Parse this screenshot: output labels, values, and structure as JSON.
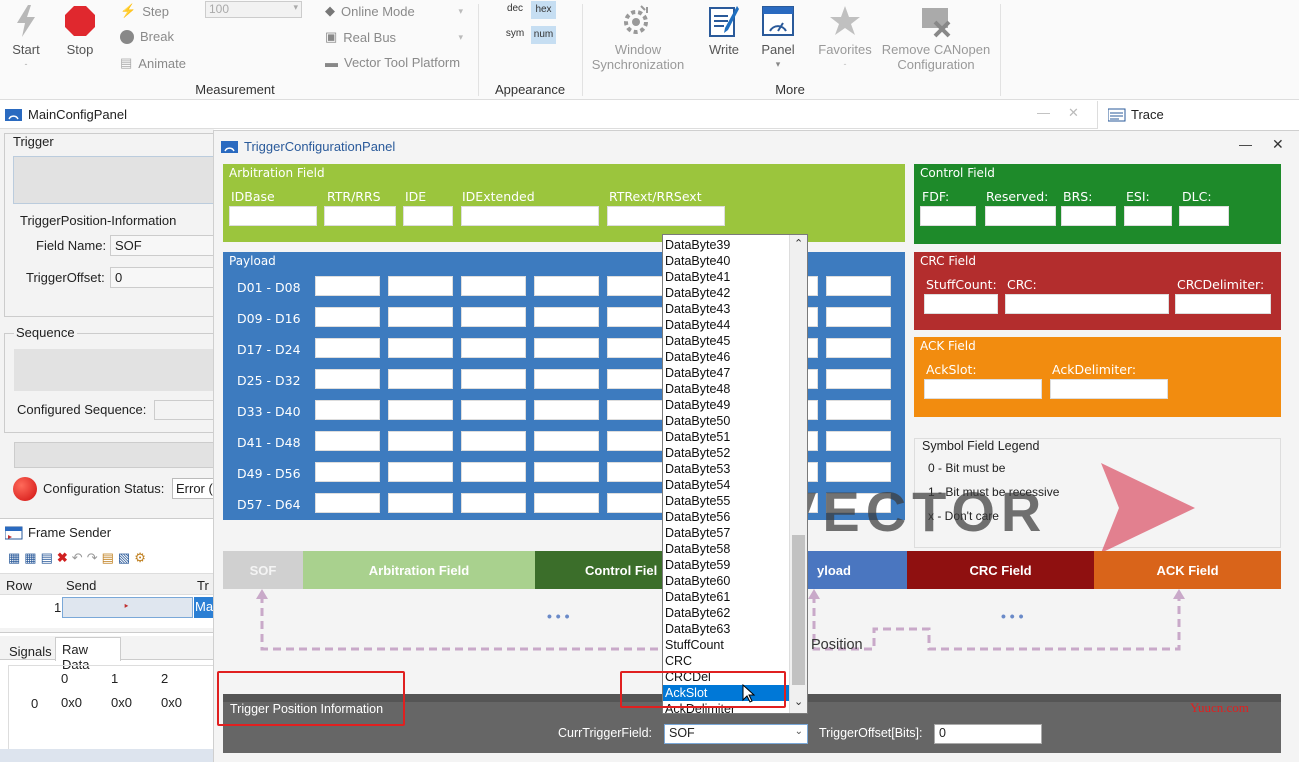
{
  "ribbon": {
    "start": "Start",
    "stop": "Stop",
    "step": "Step",
    "break": "Break",
    "animate": "Animate",
    "speed_value": "100",
    "online_mode": "Online Mode",
    "real_bus": "Real Bus",
    "vector_tool_platform": "Vector Tool Platform",
    "measurement": "Measurement",
    "dec": "dec",
    "hex": "hex",
    "sym": "sym",
    "num": "num",
    "appearance": "Appearance",
    "window_sync_l1": "Window",
    "window_sync_l2": "Synchronization",
    "write": "Write",
    "panel": "Panel",
    "favorites": "Favorites",
    "remove_canopen_l1": "Remove CANopen",
    "remove_canopen_l2": "Configuration",
    "more": "More"
  },
  "main_config_panel": {
    "title": "MainConfigPanel",
    "trigger": "Trigger",
    "trigger_pos_info": "TriggerPosition-Information",
    "field_name_label": "Field Name:",
    "field_name_value": "SOF",
    "trigger_offset_label": "TriggerOffset:",
    "trigger_offset_value": "0",
    "sequence": "Sequence",
    "configured_sequence_label": "Configured Sequence:",
    "config_status_label": "Configuration Status:",
    "config_status_value": "Error ("
  },
  "trace": {
    "title": "Trace"
  },
  "frame_sender": {
    "title": "Frame Sender",
    "col_row": "Row",
    "col_send": "Send",
    "col_tr": "Tr",
    "row1": "1",
    "row1_extra": "Ma"
  },
  "signals_tabs": {
    "signals": "Signals",
    "raw_data": "Raw Data"
  },
  "raw_data": {
    "headers": [
      "0",
      "1",
      "2"
    ],
    "row_index": "0",
    "values": [
      "0x0",
      "0x0",
      "0x0"
    ]
  },
  "trigger_panel": {
    "title": "TriggerConfigurationPanel",
    "arbitration_field": "Arbitration Field",
    "arb_labels": [
      "IDBase",
      "RTR/RRS",
      "IDE",
      "IDExtended",
      "RTRext/RRSext"
    ],
    "payload": "Payload",
    "payload_rows": [
      "D01 - D08",
      "D09 - D16",
      "D17 - D24",
      "D25 - D32",
      "D33 - D40",
      "D41 - D48",
      "D49 - D56",
      "D57 - D64"
    ],
    "control_field": "Control Field",
    "control_labels": [
      "FDF:",
      "Reserved:",
      "BRS:",
      "ESI:",
      "DLC:"
    ],
    "crc_field": "CRC Field",
    "crc_labels": [
      "StuffCount:",
      "CRC:",
      "CRCDelimiter:"
    ],
    "ack_field": "ACK Field",
    "ack_labels": [
      "AckSlot:",
      "AckDelimiter:"
    ],
    "legend_title": "Symbol Field Legend",
    "legend_items": [
      "0 - Bit must be",
      "1 - Bit must be recessive",
      "x - Don't care"
    ],
    "watermark": "VECTOR",
    "timeline": [
      "SOF",
      "Arbitration Field",
      "Control Fiel",
      "yload",
      "CRC Field",
      "ACK Field"
    ],
    "ellipsis": "• • •",
    "position_label": "Position",
    "trigger_position_information": "Trigger Position Information",
    "curr_trigger_field_label": "CurrTriggerField:",
    "curr_trigger_field_value": "SOF",
    "trigger_offset_bits_label": "TriggerOffset[Bits]:",
    "trigger_offset_bits_value": "0"
  },
  "dropdown": {
    "items": [
      "DataByte39",
      "DataByte40",
      "DataByte41",
      "DataByte42",
      "DataByte43",
      "DataByte44",
      "DataByte45",
      "DataByte46",
      "DataByte47",
      "DataByte48",
      "DataByte49",
      "DataByte50",
      "DataByte51",
      "DataByte52",
      "DataByte53",
      "DataByte54",
      "DataByte55",
      "DataByte56",
      "DataByte57",
      "DataByte58",
      "DataByte59",
      "DataByte60",
      "DataByte61",
      "DataByte62",
      "DataByte63",
      "StuffCount",
      "CRC",
      "CRCDel",
      "AckSlot",
      "AckDelimiter"
    ],
    "selected": "AckSlot"
  },
  "site_watermark": "Yuucn.com",
  "colors": {
    "arbitration": "#9bc53d",
    "payload": "#3d7bbf",
    "control": "#1e8a2a",
    "crc": "#b32d2d",
    "ack": "#f28c0f",
    "bottom_bar": "#666666",
    "selection": "#0078d7"
  }
}
